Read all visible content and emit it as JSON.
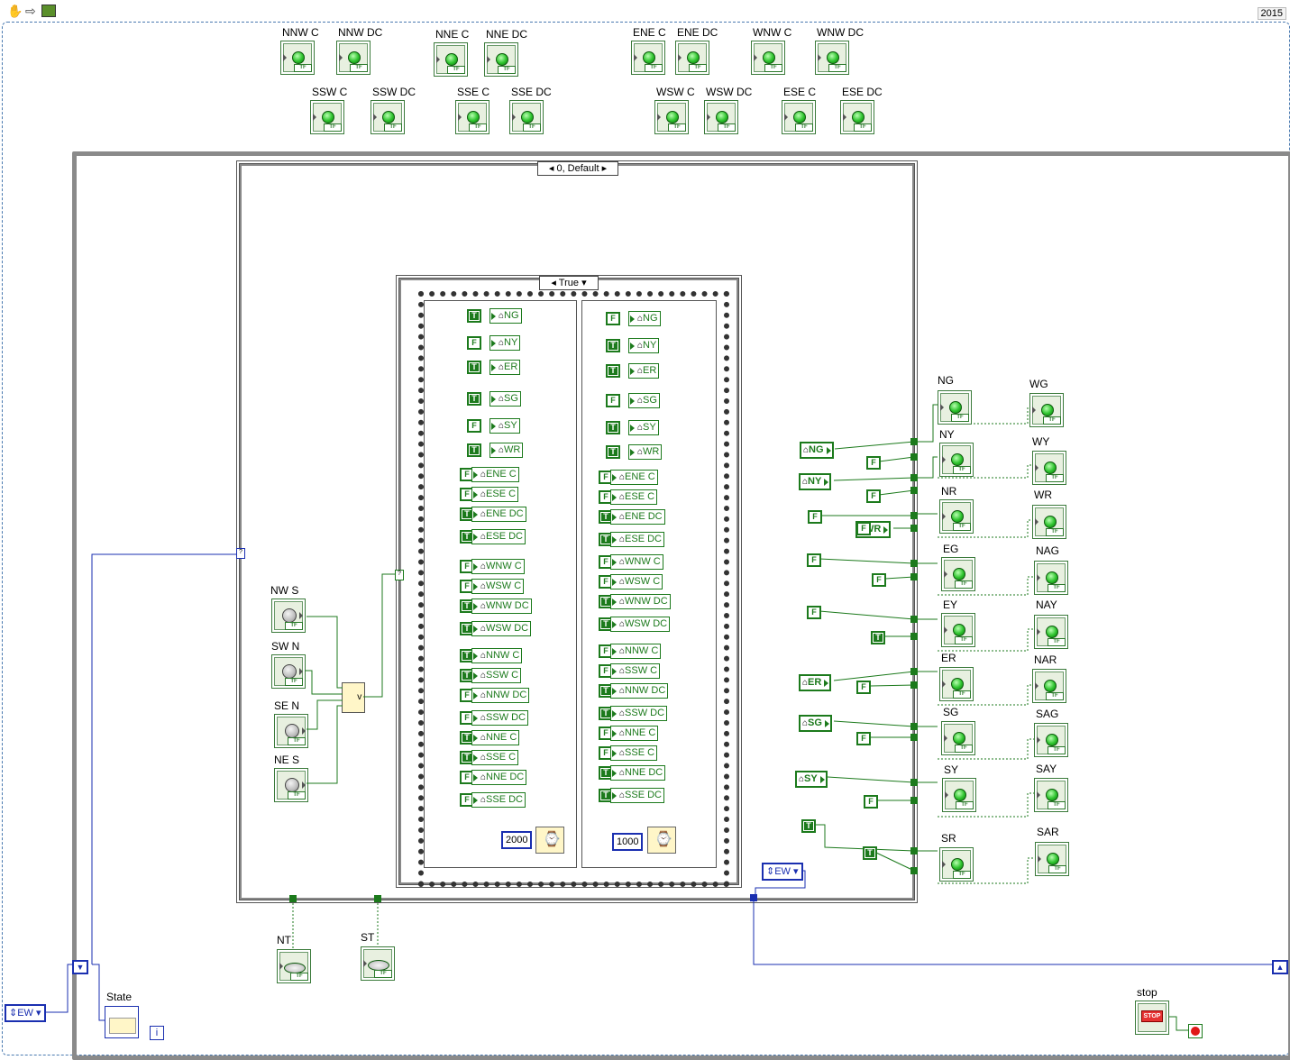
{
  "toolbar": {
    "year": "2015"
  },
  "top_indicators": [
    {
      "label": "NNW C"
    },
    {
      "label": "NNW DC"
    },
    {
      "label": "NNE C"
    },
    {
      "label": "NNE DC"
    },
    {
      "label": "ENE C"
    },
    {
      "label": "ENE DC"
    },
    {
      "label": "WNW C"
    },
    {
      "label": "WNW DC"
    },
    {
      "label": "SSW C"
    },
    {
      "label": "SSW DC"
    },
    {
      "label": "SSE C"
    },
    {
      "label": "SSE DC"
    },
    {
      "label": "WSW C"
    },
    {
      "label": "WSW DC"
    },
    {
      "label": "ESE C"
    },
    {
      "label": "ESE DC"
    }
  ],
  "outer_case": {
    "selector": "0, Default"
  },
  "inner_case": {
    "selector": "True"
  },
  "frame1": {
    "rows": [
      {
        "const": "T",
        "var": "NG"
      },
      {
        "const": "F",
        "var": "NY"
      },
      {
        "const": "T",
        "var": "ER"
      },
      {
        "const": "T",
        "var": "SG"
      },
      {
        "const": "F",
        "var": "SY"
      },
      {
        "const": "T",
        "var": "WR"
      },
      {
        "const": "F",
        "var": "ENE C"
      },
      {
        "const": "F",
        "var": "ESE C"
      },
      {
        "const": "T",
        "var": "ENE DC"
      },
      {
        "const": "T",
        "var": "ESE DC"
      },
      {
        "const": "F",
        "var": "WNW C"
      },
      {
        "const": "F",
        "var": "WSW C"
      },
      {
        "const": "T",
        "var": "WNW DC"
      },
      {
        "const": "T",
        "var": "WSW DC"
      },
      {
        "const": "T",
        "var": "NNW C"
      },
      {
        "const": "T",
        "var": "SSW C"
      },
      {
        "const": "F",
        "var": "NNW DC"
      },
      {
        "const": "F",
        "var": "SSW DC"
      },
      {
        "const": "T",
        "var": "NNE C"
      },
      {
        "const": "T",
        "var": "SSE C"
      },
      {
        "const": "F",
        "var": "NNE DC"
      },
      {
        "const": "F",
        "var": "SSE DC"
      }
    ],
    "wait_ms": "2000"
  },
  "frame2": {
    "rows": [
      {
        "const": "F",
        "var": "NG"
      },
      {
        "const": "T",
        "var": "NY"
      },
      {
        "const": "T",
        "var": "ER"
      },
      {
        "const": "F",
        "var": "SG"
      },
      {
        "const": "T",
        "var": "SY"
      },
      {
        "const": "T",
        "var": "WR"
      },
      {
        "const": "F",
        "var": "ENE C"
      },
      {
        "const": "F",
        "var": "ESE C"
      },
      {
        "const": "T",
        "var": "ENE DC"
      },
      {
        "const": "T",
        "var": "ESE DC"
      },
      {
        "const": "F",
        "var": "WNW C"
      },
      {
        "const": "F",
        "var": "WSW C"
      },
      {
        "const": "T",
        "var": "WNW DC"
      },
      {
        "const": "T",
        "var": "WSW DC"
      },
      {
        "const": "F",
        "var": "NNW C"
      },
      {
        "const": "F",
        "var": "SSW C"
      },
      {
        "const": "T",
        "var": "NNW DC"
      },
      {
        "const": "T",
        "var": "SSW DC"
      },
      {
        "const": "F",
        "var": "NNE C"
      },
      {
        "const": "F",
        "var": "SSE C"
      },
      {
        "const": "T",
        "var": "NNE DC"
      },
      {
        "const": "T",
        "var": "SSE DC"
      }
    ],
    "wait_ms": "1000"
  },
  "sensors": [
    {
      "label": "NW S"
    },
    {
      "label": "SW N"
    },
    {
      "label": "SE N"
    },
    {
      "label": "NE S"
    }
  ],
  "bottom_controls": [
    {
      "label": "NT"
    },
    {
      "label": "ST"
    }
  ],
  "state": {
    "label": "State",
    "enum_value": "EW",
    "iteration_label": "i"
  },
  "next_state": {
    "enum_value": "EW"
  },
  "stop": {
    "label": "stop",
    "button_text": "STOP"
  },
  "right_column1": [
    {
      "label": "NG"
    },
    {
      "label": "NY"
    },
    {
      "label": "NR"
    },
    {
      "label": "EG"
    },
    {
      "label": "EY"
    },
    {
      "label": "ER"
    },
    {
      "label": "SG"
    },
    {
      "label": "SY"
    },
    {
      "label": "SR"
    }
  ],
  "right_column2": [
    {
      "label": "WG"
    },
    {
      "label": "WY"
    },
    {
      "label": "WR"
    },
    {
      "label": "NAG"
    },
    {
      "label": "NAY"
    },
    {
      "label": "NAR"
    },
    {
      "label": "SAG"
    },
    {
      "label": "SAY"
    },
    {
      "label": "SAR"
    }
  ],
  "local_reads": [
    "NG",
    "NY",
    "WR",
    "ER",
    "SG",
    "SY"
  ],
  "right_consts": [
    "F",
    "F",
    "F",
    "F",
    "F",
    "F",
    "F",
    "T",
    "F",
    "F",
    "F",
    "T"
  ]
}
